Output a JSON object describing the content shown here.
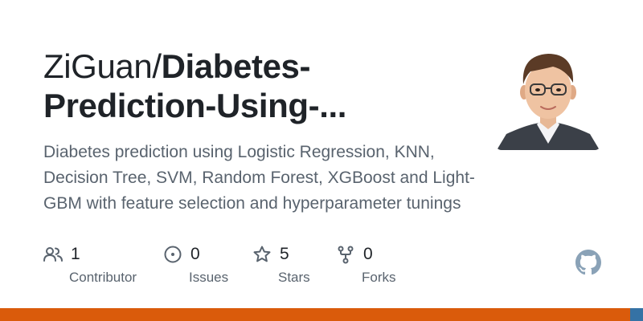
{
  "repo": {
    "owner": "ZiGuan/",
    "name_line1": "Diabetes-",
    "name_line2": "Prediction-Using-..."
  },
  "description": "Diabetes prediction using Logistic Regression, KNN, Decision Tree, SVM, Random Forest, XGBoost and Light-GBM with feature selection and hyperparameter tunings",
  "stats": {
    "contributors": {
      "count": "1",
      "label": "Contributor",
      "icon": "people-icon"
    },
    "issues": {
      "count": "0",
      "label": "Issues",
      "icon": "issue-opened-icon"
    },
    "stars": {
      "count": "5",
      "label": "Stars",
      "icon": "star-icon"
    },
    "forks": {
      "count": "0",
      "label": "Forks",
      "icon": "repo-forked-icon"
    }
  },
  "colors": {
    "title": "#1f2328",
    "muted": "#59636e",
    "language_bar_primary": "#da5b0b",
    "language_bar_secondary": "#3572a5",
    "github_logo": "#8aa2b7"
  }
}
